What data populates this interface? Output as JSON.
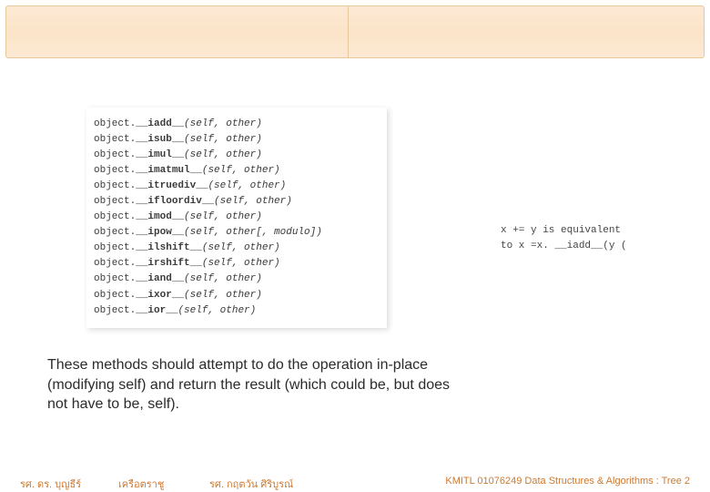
{
  "methods": [
    {
      "prefix": "object.",
      "name": "__iadd__",
      "args": "(self, other)"
    },
    {
      "prefix": "object.",
      "name": "__isub__",
      "args": "(self, other)"
    },
    {
      "prefix": "object.",
      "name": "__imul__",
      "args": "(self, other)"
    },
    {
      "prefix": "object.",
      "name": "__imatmul__",
      "args": "(self, other)"
    },
    {
      "prefix": "object.",
      "name": "__itruediv__",
      "args": "(self, other)"
    },
    {
      "prefix": "object.",
      "name": "__ifloordiv__",
      "args": "(self, other)"
    },
    {
      "prefix": "object.",
      "name": "__imod__",
      "args": "(self, other)"
    },
    {
      "prefix": "object.",
      "name": "__ipow__",
      "args": "(self, other[, modulo])"
    },
    {
      "prefix": "object.",
      "name": "__ilshift__",
      "args": "(self, other)"
    },
    {
      "prefix": "object.",
      "name": "__irshift__",
      "args": "(self, other)"
    },
    {
      "prefix": "object.",
      "name": "__iand__",
      "args": "(self, other)"
    },
    {
      "prefix": "object.",
      "name": "__ixor__",
      "args": "(self, other)"
    },
    {
      "prefix": "object.",
      "name": "__ior__",
      "args": "(self, other)"
    }
  ],
  "note": {
    "line1": "x += y  is              equivalent",
    "line2": "to  x =x. __iadd__(y   ("
  },
  "body": "These methods should attempt to do the operation in-place (modifying self) and return the result (which could be, but does not have to be, self).",
  "footer": {
    "left": "รศ. ดร. บุญธีร์",
    "mid": "เครือตราชู",
    "mid2": "รศ. กฤตวัน    ศิริบูรณ์",
    "right": "KMITL   01076249 Data Structures & Algorithms : Tree 2"
  }
}
